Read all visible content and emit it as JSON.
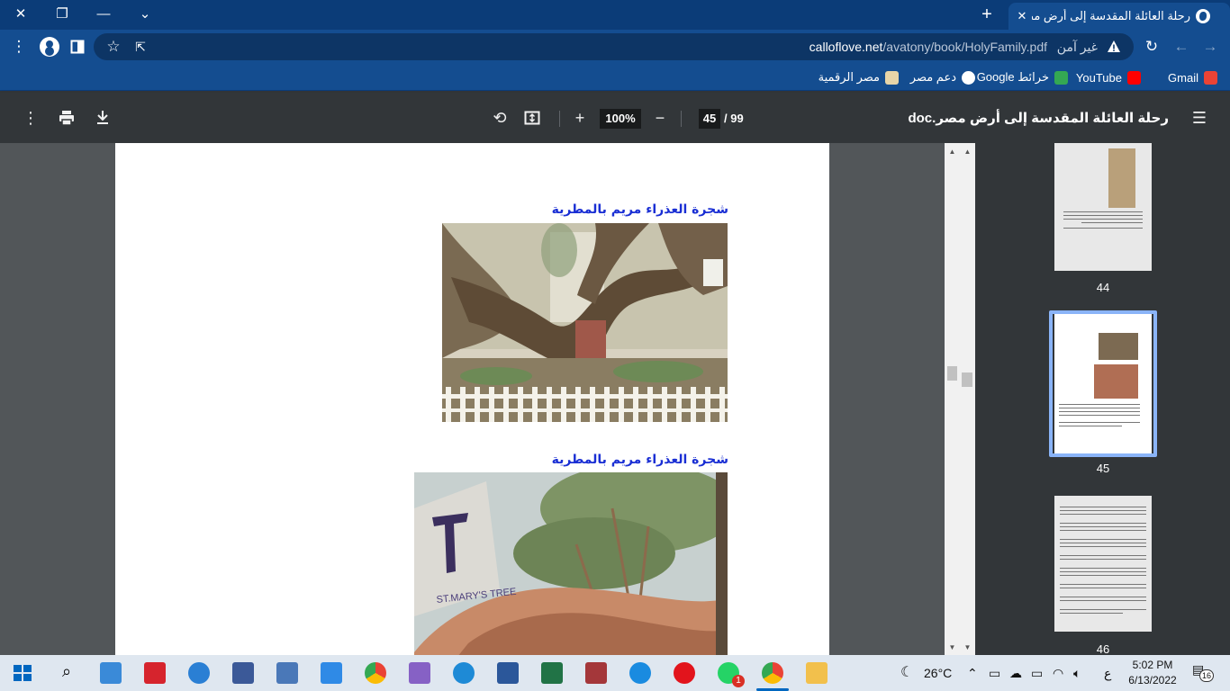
{
  "window": {
    "tab_title": "رحلة العائلة المقدسة إلى أرض مصر",
    "close_tab": "✕",
    "new_tab": "+"
  },
  "address_bar": {
    "security_label": "غير آمن",
    "url_domain": "calloflove.net",
    "url_path": "/avatony/book/HolyFamily.pdf"
  },
  "bookmarks": [
    {
      "label": "Gmail",
      "color": "#ea4335"
    },
    {
      "label": "YouTube",
      "color": "#ff0000"
    },
    {
      "label": "خرائط Google",
      "color": "#34a853"
    },
    {
      "label": "دعم مصر",
      "color": "#ffffff"
    },
    {
      "label": "مصر الرقمية",
      "color": "#e8d5a8"
    }
  ],
  "pdf_toolbar": {
    "document_title": "رحلة العائلة المقدسة إلى أرض مصر.doc",
    "current_page": "45",
    "page_separator": "/",
    "total_pages": "99",
    "zoom": "100%"
  },
  "document": {
    "caption_1": "شجرة العذراء مريم بالمطرية",
    "caption_2": "شجرة العذراء مريم بالمطرية",
    "sign_text": "ST.MARY'S TREE"
  },
  "thumbnails": [
    {
      "page": "44"
    },
    {
      "page": "45"
    },
    {
      "page": "46"
    }
  ],
  "taskbar": {
    "temperature": "26°C",
    "time": "5:02 PM",
    "date": "6/13/2022",
    "lang": "ع",
    "notifications": "16",
    "whatsapp_badge": "1"
  },
  "colors": {
    "chrome_blue": "#144d90",
    "pdf_toolbar": "#323639",
    "caption_blue": "#1a2fd4",
    "selected_thumb": "#8ab4f8"
  }
}
